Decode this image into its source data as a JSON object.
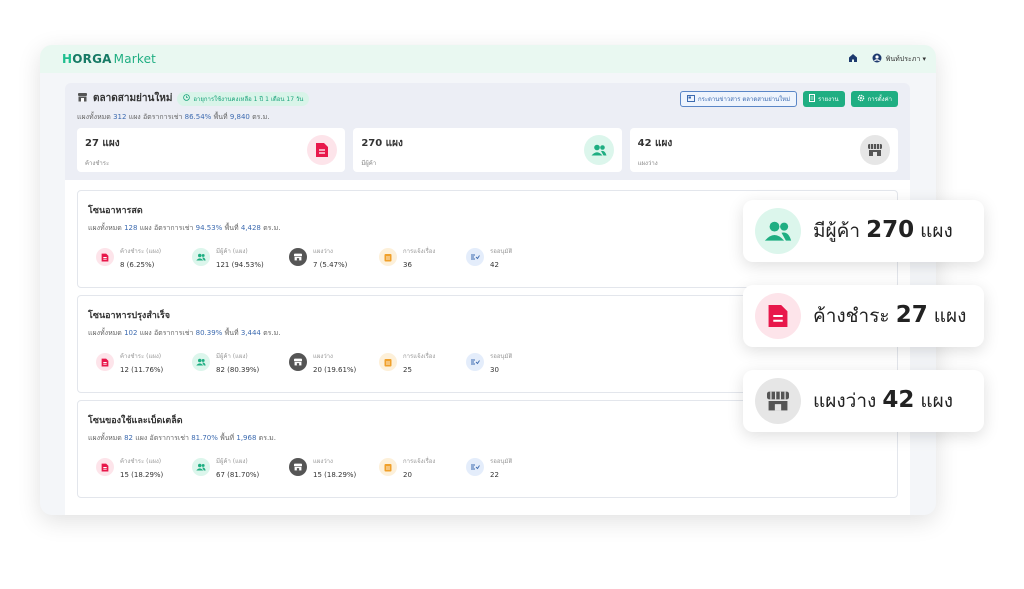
{
  "app": {
    "logo_prefix": "H",
    "logo_main": "ORGA",
    "logo_suffix": "Market"
  },
  "topbar": {
    "user_label": "พินท์ประภา ▾"
  },
  "header": {
    "title": "ตลาดสามย่านใหม่",
    "note": "อายุการใช้งานคงเหลือ 1 ปี 1 เดือน 17 วัน",
    "sub_total_label": "แผงทั้งหมด",
    "sub_total_value": "312",
    "sub_unit": "แผง",
    "sub_rate_label": "อัตราการเช่า",
    "sub_rate_value": "86.54%",
    "sub_area_label": "พื้นที่",
    "sub_area_value": "9,840",
    "sub_area_unit": "ตร.ม.",
    "btn_news": "กระดานข่าวสาร ตลาดสามย่านใหม่",
    "btn_report": "รายงาน",
    "btn_settings": "การตั้งค่า"
  },
  "cards": [
    {
      "num": "27 แผง",
      "label": "ค้างชำระ",
      "icon": "document-icon",
      "bg": "#fde4ea",
      "fg": "#e8184b"
    },
    {
      "num": "270 แผง",
      "label": "มีผู้ค้า",
      "icon": "users-icon",
      "bg": "#dcf6ec",
      "fg": "#1fae82"
    },
    {
      "num": "42 แผง",
      "label": "แผงว่าง",
      "icon": "store-icon",
      "bg": "#e6e6e6",
      "fg": "#555555"
    }
  ],
  "zones": [
    {
      "title": "โซนอาหารสด",
      "total_label": "แผงทั้งหมด",
      "total": "128",
      "unit": "แผง",
      "rate_label": "อัตราการเช่า",
      "rate": "94.53%",
      "area_label": "พื้นที่",
      "area": "4,428",
      "area_unit": "ตร.ม.",
      "stats": [
        {
          "label": "ค้างชำระ (แผง)",
          "value": "8 (6.25%)"
        },
        {
          "label": "มีผู้ค้า (แผง)",
          "value": "121 (94.53%)"
        },
        {
          "label": "แผงว่าง",
          "value": "7 (5.47%)"
        },
        {
          "label": "การแจ้งเรื่อง",
          "value": "36"
        },
        {
          "label": "รออนุมัติ",
          "value": "42"
        }
      ]
    },
    {
      "title": "โซนอาหารปรุงสำเร็จ",
      "total_label": "แผงทั้งหมด",
      "total": "102",
      "unit": "แผง",
      "rate_label": "อัตราการเช่า",
      "rate": "80.39%",
      "area_label": "พื้นที่",
      "area": "3,444",
      "area_unit": "ตร.ม.",
      "stats": [
        {
          "label": "ค้างชำระ (แผง)",
          "value": "12 (11.76%)"
        },
        {
          "label": "มีผู้ค้า (แผง)",
          "value": "82 (80.39%)"
        },
        {
          "label": "แผงว่าง",
          "value": "20 (19.61%)"
        },
        {
          "label": "การแจ้งเรื่อง",
          "value": "25"
        },
        {
          "label": "รออนุมัติ",
          "value": "30"
        }
      ]
    },
    {
      "title": "โซนของใช้และเบ็ดเตล็ด",
      "total_label": "แผงทั้งหมด",
      "total": "82",
      "unit": "แผง",
      "rate_label": "อัตราการเช่า",
      "rate": "81.70%",
      "area_label": "พื้นที่",
      "area": "1,968",
      "area_unit": "ตร.ม.",
      "stats": [
        {
          "label": "ค้างชำระ (แผง)",
          "value": "15 (18.29%)"
        },
        {
          "label": "มีผู้ค้า (แผง)",
          "value": "67 (81.70%)"
        },
        {
          "label": "แผงว่าง",
          "value": "15 (18.29%)"
        },
        {
          "label": "การแจ้งเรื่อง",
          "value": "20"
        },
        {
          "label": "รออนุมัติ",
          "value": "22"
        }
      ]
    }
  ],
  "callouts": [
    {
      "pre": "มีผู้ค้า",
      "num": "270",
      "unit": "แผง"
    },
    {
      "pre": "ค้างชำระ",
      "num": "27",
      "unit": "แผง"
    },
    {
      "pre": "แผงว่าง",
      "num": "42",
      "unit": "แผง"
    }
  ],
  "colors": {
    "brand": "#1fae82",
    "danger": "#e8184b",
    "link": "#3d6bb0"
  }
}
